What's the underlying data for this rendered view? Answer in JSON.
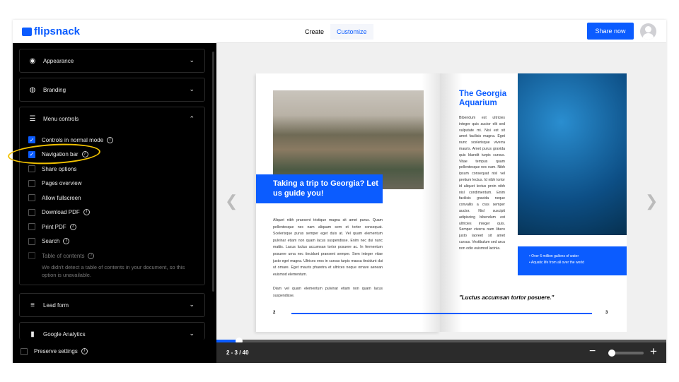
{
  "header": {
    "logo": "flipsnack",
    "tabs": [
      {
        "label": "Create"
      },
      {
        "label": "Customize"
      }
    ],
    "share_label": "Share now"
  },
  "sidebar": {
    "panels": [
      {
        "label": "Appearance",
        "icon": "eye-icon"
      },
      {
        "label": "Branding",
        "icon": "palette-icon"
      },
      {
        "label": "Menu controls",
        "icon": "sliders-icon"
      },
      {
        "label": "Lead form",
        "icon": "lines-icon"
      },
      {
        "label": "Google Analytics",
        "icon": "bar-chart-icon"
      }
    ],
    "options": [
      {
        "label": "Controls in normal mode",
        "checked": true,
        "info": true
      },
      {
        "label": "Navigation bar",
        "checked": true,
        "info": true
      },
      {
        "label": "Share options",
        "checked": false
      },
      {
        "label": "Pages overview",
        "checked": false
      },
      {
        "label": "Allow fullscreen",
        "checked": false
      },
      {
        "label": "Download PDF",
        "checked": false,
        "info": true
      },
      {
        "label": "Print PDF",
        "checked": false,
        "info": true
      },
      {
        "label": "Search",
        "checked": false,
        "info": true
      },
      {
        "label": "Table of contents",
        "checked": false,
        "info": true,
        "disabled": true
      }
    ],
    "toc_note": "We didn't detect a table of contents in your document, so this option is unavailable.",
    "preserve_label": "Preserve settings"
  },
  "book": {
    "left": {
      "callout": "Taking a trip to Georgia? Let us guide you!",
      "para1": "Aliquet nibh praesent tristique magna sit amet purus. Quam pellentesque nec nam aliquam sem et tortor consequat. Scelerisque purus semper eget duis at. Vel quam elementum pulvinar etiam non quam lacus suspendisse. Enim nec dui nunc mattis. Lacus luctus accumsan tortor posuere ac. In fermentum posuere urna nec tincidunt praesent semper. Sem integer vitae justo eget magna. Ultrices eros in cursus turpis massa tincidunt dui ut ornare. Eget mauris pharetra et ultrices neque ornare aenean euismod elementum.",
      "para2": "Diam vel quam elementum pulvinar etiam non quam lacus suspendisse.",
      "page_number": "2"
    },
    "right": {
      "title": "The Georgia Aquarium",
      "para": "Bibendum est ultricies integer quis auctor elit sed vulputate mi. Nisi est sit amet facilisis magna. Eget nunc scelerisque viverra mauris. Amet purus gravida quis blandit turpis cursus. Vitae tempus quam pellentesque nec nam. Nibh ipsum consequat nisl vel pretium lectus. Id nibh tortor id aliquet lectus proin nibh nisl condimentum. Enim facilisis gravida neque convallis a cras semper auctor. Nisl suscipit adipiscing bibendum est ultricies integer quis. Semper viverra nam libero justo laoreet sit amet cursus. Vestibulum sed arcu non odio euismod lacinia.",
      "bullets": [
        "• Over 6 million gallons of water",
        "• Aquatic life from all over the world"
      ],
      "quote": "\"Luctus accumsan tortor posuere.\"",
      "page_number": "3"
    }
  },
  "viewer": {
    "page_indicator": "2 - 3 / 40",
    "progress_fraction": 0.05,
    "zoom_fraction": 0.05
  },
  "colors": {
    "accent": "#0b5cff",
    "highlight": "#f2c200"
  }
}
